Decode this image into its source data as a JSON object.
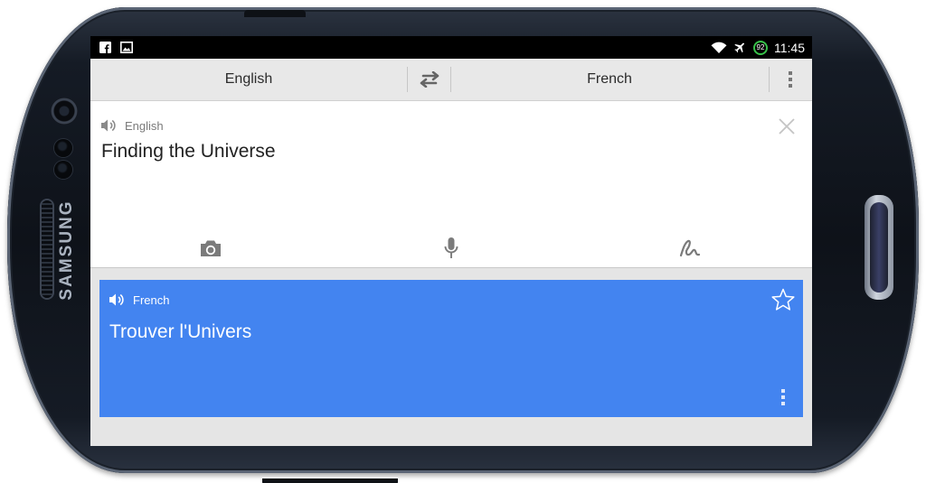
{
  "status_bar": {
    "time": "11:45",
    "battery_level": "92",
    "icons_left": [
      "facebook-icon",
      "image-icon"
    ],
    "icons_right": [
      "wifi-icon",
      "airplane-mode-icon"
    ],
    "battery_color": "#38c24a"
  },
  "language_bar": {
    "source_language": "English",
    "target_language": "French",
    "swap_icon": "swap-arrows-icon",
    "menu_icon": "overflow-menu-icon"
  },
  "input": {
    "language_label": "English",
    "text": "Finding the Universe",
    "speaker_icon": "speaker-icon",
    "clear_icon": "close-icon",
    "tools": [
      "camera-icon",
      "microphone-icon",
      "handwriting-icon"
    ]
  },
  "result": {
    "language_label": "French",
    "text": "Trouver l'Univers",
    "background_color": "#4384f0",
    "star_icon": "star-outline-icon",
    "menu_icon": "overflow-menu-icon"
  },
  "device": {
    "brand": "SAMSUNG"
  }
}
